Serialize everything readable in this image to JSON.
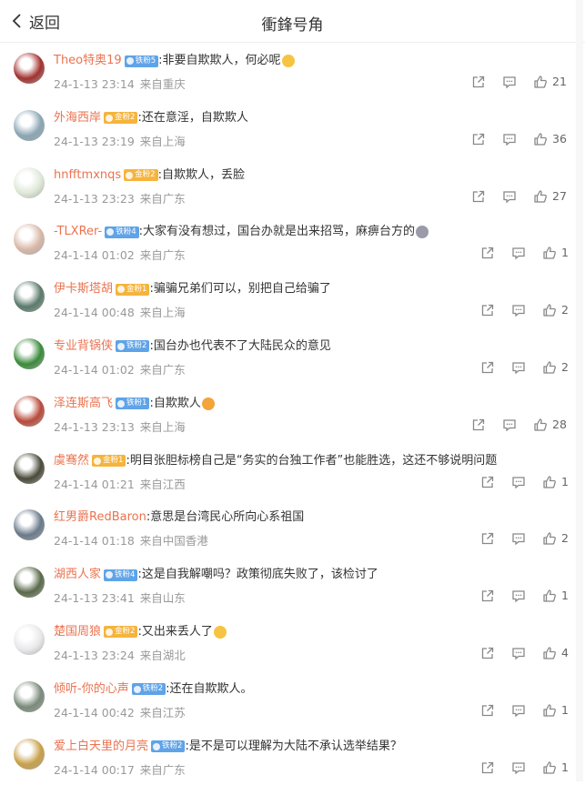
{
  "header": {
    "back_label": "返回",
    "title": "衝鋒号角"
  },
  "comments": [
    {
      "user": "Theo特奥19",
      "badge": "铁粉5",
      "badge_color": "#5fa3e8",
      "text": ":非要自欺欺人，何必呢",
      "emoji": "smile-emoji",
      "time": "24-1-13 23:14",
      "location": "来自重庆",
      "likes": "21",
      "avatar_color": "#a0322f"
    },
    {
      "user": "外海西岸",
      "badge": "金粉2",
      "badge_color": "#f5b43d",
      "text": ":还在意淫，自欺欺人",
      "emoji": "",
      "time": "24-1-13 23:19",
      "location": "来自上海",
      "likes": "36",
      "avatar_color": "#8aa6b4"
    },
    {
      "user": "hnfftmxnqs",
      "badge": "金粉2",
      "badge_color": "#f5b43d",
      "text": ":自欺欺人，丢脸",
      "emoji": "",
      "time": "24-1-13 23:23",
      "location": "来自广东",
      "likes": "27",
      "avatar_color": "#dfe8d8"
    },
    {
      "user": "-TLXRer-",
      "badge": "铁粉4",
      "badge_color": "#5fa3e8",
      "text": ":大家有没有想过，国台办就是出来招骂，麻痹台方的",
      "emoji": "dog-emoji",
      "time": "24-1-14 01:02",
      "location": "来自广东",
      "likes": "1",
      "avatar_color": "#d8b8a8"
    },
    {
      "user": "伊卡斯塔胡",
      "badge": "金粉1",
      "badge_color": "#f5b43d",
      "text": ":骗骗兄弟们可以，别把自己给骗了",
      "emoji": "",
      "time": "24-1-14 00:48",
      "location": "来自上海",
      "likes": "2",
      "avatar_color": "#5a7a6a"
    },
    {
      "user": "专业背锅侠",
      "badge": "铁粉2",
      "badge_color": "#5fa3e8",
      "text": ":国台办也代表不了大陆民众的意见",
      "emoji": "",
      "time": "24-1-14 01:02",
      "location": "来自广东",
      "likes": "2",
      "avatar_color": "#3a8a3a"
    },
    {
      "user": "泽连斯高飞",
      "badge": "铁粉1",
      "badge_color": "#5fa3e8",
      "text": ":自欺欺人",
      "emoji": "crown-emoji",
      "time": "24-1-13 23:13",
      "location": "来自上海",
      "likes": "28",
      "avatar_color": "#b84a3a"
    },
    {
      "user": "虞骞然",
      "badge": "金粉1",
      "badge_color": "#f5b43d",
      "text": ":明目张胆标榜自己是“务实的台独工作者”也能胜选，这还不够说明问题",
      "emoji": "",
      "time": "24-1-14 01:21",
      "location": "来自江西",
      "likes": "1",
      "avatar_color": "#4a4a3a"
    },
    {
      "user": "红男爵RedBaron",
      "badge": "",
      "badge_color": "",
      "text": ":意思是台湾民心所向心系祖国",
      "emoji": "",
      "time": "24-1-14 01:18",
      "location": "来自中国香港",
      "likes": "2",
      "avatar_color": "#6a7a8a"
    },
    {
      "user": "湖西人家",
      "badge": "铁粉4",
      "badge_color": "#5fa3e8",
      "text": ":这是自我解嘲吗？政策彻底失败了，该检讨了",
      "emoji": "",
      "time": "24-1-13 23:41",
      "location": "来自山东",
      "likes": "1",
      "avatar_color": "#5a6a4a"
    },
    {
      "user": "楚国周狼",
      "badge": "金粉2",
      "badge_color": "#f5b43d",
      "text": ":又出来丢人了",
      "emoji": "sweat-emoji",
      "time": "24-1-13 23:24",
      "location": "来自湖北",
      "likes": "4",
      "avatar_color": "#e8e8ea"
    },
    {
      "user": "倾听-你的心声",
      "badge": "铁粉2",
      "badge_color": "#5fa3e8",
      "text": ":还在自欺欺人。",
      "emoji": "",
      "time": "24-1-14 00:42",
      "location": "来自江苏",
      "likes": "1",
      "avatar_color": "#7a8a7a"
    },
    {
      "user": "爱上白天里的月亮",
      "badge": "铁粉2",
      "badge_color": "#5fa3e8",
      "text": ":是不是可以理解为大陆不承认选举结果？",
      "emoji": "",
      "time": "24-1-14 00:17",
      "location": "来自广东",
      "likes": "1",
      "avatar_color": "#c8a048"
    }
  ],
  "icons": {
    "back": "chevron-left-icon",
    "share": "share-icon",
    "comment": "comment-icon",
    "like": "thumbs-up-icon"
  }
}
